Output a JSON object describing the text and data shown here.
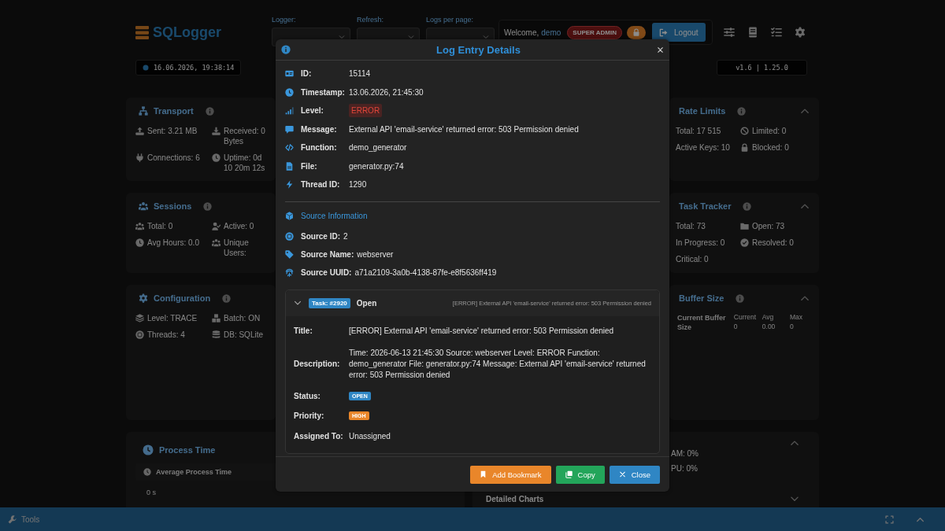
{
  "header": {
    "logo": "SQLogger",
    "filters": [
      {
        "label": "Logger:"
      },
      {
        "label": "Refresh:"
      },
      {
        "label": "Logs per page:"
      }
    ],
    "welcome": "Welcome,",
    "user": "demo",
    "role": "SUPER ADMIN",
    "logout": "Logout"
  },
  "clock": "16.06.2026, 19:38:14",
  "version": "v1.6 | 1.25.0",
  "left_cards": [
    {
      "title": "Transport",
      "items": [
        "Sent: 3.21 MB",
        "Received: 0 Bytes",
        "Connections: 6",
        "Uptime: 0d 10 20m 12s"
      ]
    },
    {
      "title": "Sessions",
      "items": [
        "Total: 0",
        "Active: 0",
        "Avg Hours: 0.0",
        "Unique Users:"
      ]
    },
    {
      "title": "Configuration",
      "items": [
        "Level: TRACE",
        "Batch: ON",
        "Threads: 4",
        "DB: SQLite"
      ]
    }
  ],
  "right_cards": [
    {
      "title": "Rate Limits",
      "items": [
        "Total: 17 515",
        "Limited: 0",
        "Active Keys: 10",
        "Blocked: 0"
      ]
    },
    {
      "title": "Task Tracker",
      "items": [
        "Total: 73",
        "Open: 73",
        "In Progress: 0",
        "Resolved: 0",
        "Critical: 0"
      ]
    },
    {
      "title": "Buffer Size",
      "buffer": {
        "label": "Current Buffer Size",
        "stats": [
          {
            "label": "Current",
            "value": "0"
          },
          {
            "label": "Avg",
            "value": "0.00"
          },
          {
            "label": "Max",
            "value": "0"
          }
        ]
      }
    }
  ],
  "process_time": {
    "title": "Process Time",
    "metric": "Average Process Time",
    "value": "0 s"
  },
  "system_card": {
    "items": [
      "AM: 0%",
      "PU: 0%"
    ],
    "charts_title": "Detailed Charts"
  },
  "modal": {
    "title": "Log Entry Details",
    "fields": [
      {
        "label": "ID:",
        "value": "15114",
        "kind": "text"
      },
      {
        "label": "Timestamp:",
        "value": "13.06.2026, 21:45:30",
        "kind": "text"
      },
      {
        "label": "Level:",
        "value": "ERROR",
        "kind": "level"
      },
      {
        "label": "Message:",
        "value": "External API 'email-service' returned error: 503 Permission denied",
        "kind": "text"
      },
      {
        "label": "Function:",
        "value": "demo_generator",
        "kind": "text"
      },
      {
        "label": "File:",
        "value": "generator.py:74",
        "kind": "text"
      },
      {
        "label": "Thread ID:",
        "value": "1290",
        "kind": "text"
      }
    ],
    "source_heading": "Source Information",
    "source_fields": [
      {
        "label": "Source ID:",
        "value": "2"
      },
      {
        "label": "Source Name:",
        "value": "webserver"
      },
      {
        "label": "Source UUID:",
        "value": "a71a2109-3a0b-4138-87fe-e8f5636ff419"
      }
    ],
    "task": {
      "expanded": true,
      "badge": "Task: #2920",
      "status": "Open",
      "summary": "[ERROR] External API 'email-service' returned error: 503 Permission denied",
      "fields": [
        {
          "label": "Title:",
          "value": "[ERROR] External API 'email-service' returned error: 503 Permission denied",
          "kind": "text"
        },
        {
          "label": "Description:",
          "value": "Time: 2026-06-13 21:45:30 Source: webserver Level: ERROR Function: demo_generator File: generator.py:74 Message: External API 'email-service' returned error: 503 Permission denied",
          "kind": "text"
        },
        {
          "label": "Status:",
          "value": "OPEN",
          "kind": "badge",
          "color": "#2f86c4"
        },
        {
          "label": "Priority:",
          "value": "HIGH",
          "kind": "badge",
          "color": "#e9862a"
        },
        {
          "label": "Assigned To:",
          "value": "Unassigned",
          "kind": "text"
        }
      ]
    },
    "buttons": [
      {
        "label": "Add Bookmark",
        "color": "#e9862a"
      },
      {
        "label": "Copy",
        "color": "#23a55a"
      },
      {
        "label": "Close",
        "color": "#2f86c4"
      }
    ]
  },
  "bottom_bar": {
    "label": "Tools"
  }
}
